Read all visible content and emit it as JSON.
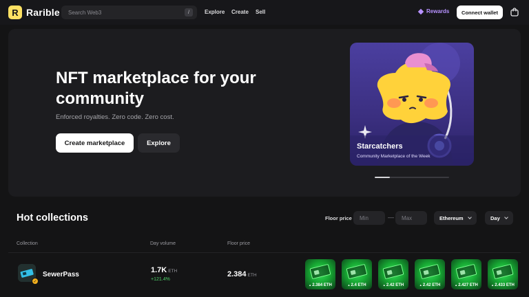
{
  "nav": {
    "brand": "Rarible",
    "logo_letter": "R",
    "search_placeholder": "Search Web3",
    "search_shortcut": "/",
    "links": [
      "Explore",
      "Create",
      "Sell"
    ],
    "rewards": "Rewards",
    "connect": "Connect wallet"
  },
  "hero": {
    "title": "NFT marketplace for your community",
    "subtitle": "Enforced royalties. Zero code. Zero cost.",
    "create_button": "Create marketplace",
    "explore_button": "Explore",
    "featured": {
      "title": "Starcatchers",
      "subtitle": "Community Marketplace of the Week"
    },
    "carousel_progress": 0.2
  },
  "hot": {
    "title": "Hot collections",
    "floor_label": "Floor price",
    "min_placeholder": "Min",
    "max_placeholder": "Max",
    "dash": "—",
    "chain": "Ethereum",
    "period": "Day",
    "columns": {
      "collection": "Collection",
      "volume": "Day volume",
      "floor": "Floor price"
    },
    "rows": [
      {
        "name": "SewerPass",
        "volume": "1.7K",
        "volume_unit": "ETH",
        "change": "+121.4%",
        "floor": "2.384",
        "floor_unit": "ETH",
        "items": [
          "2.384 ETH",
          "2.4 ETH",
          "2.42 ETH",
          "2.42 ETH",
          "2.427 ETH",
          "2.433 ETH"
        ]
      }
    ]
  },
  "colors": {
    "background": "#141415",
    "accent": "#fee163",
    "rewards": "#b792ff",
    "positive": "#4fd36a"
  }
}
